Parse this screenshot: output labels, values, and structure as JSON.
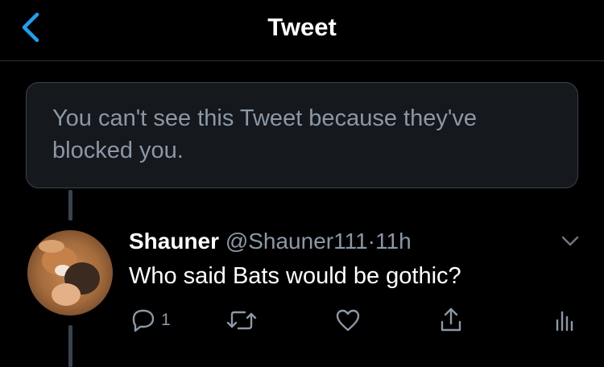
{
  "header": {
    "title": "Tweet"
  },
  "blocked_notice": {
    "text": "You can't see this Tweet because they've blocked you."
  },
  "tweet": {
    "name": "Shauner",
    "handle": "@Shauner111",
    "separator": "·",
    "time": "11h",
    "text": "Who said Bats would be gothic?",
    "reply_count": "1"
  },
  "icons": {
    "back": "chevron-left-icon",
    "more": "chevron-down-icon",
    "reply": "comment-icon",
    "retweet": "retweet-icon",
    "like": "heart-icon",
    "share": "share-icon",
    "analytics": "analytics-icon"
  },
  "colors": {
    "accent": "#1da1f2",
    "muted": "#8b98a5",
    "border": "#38444d"
  }
}
